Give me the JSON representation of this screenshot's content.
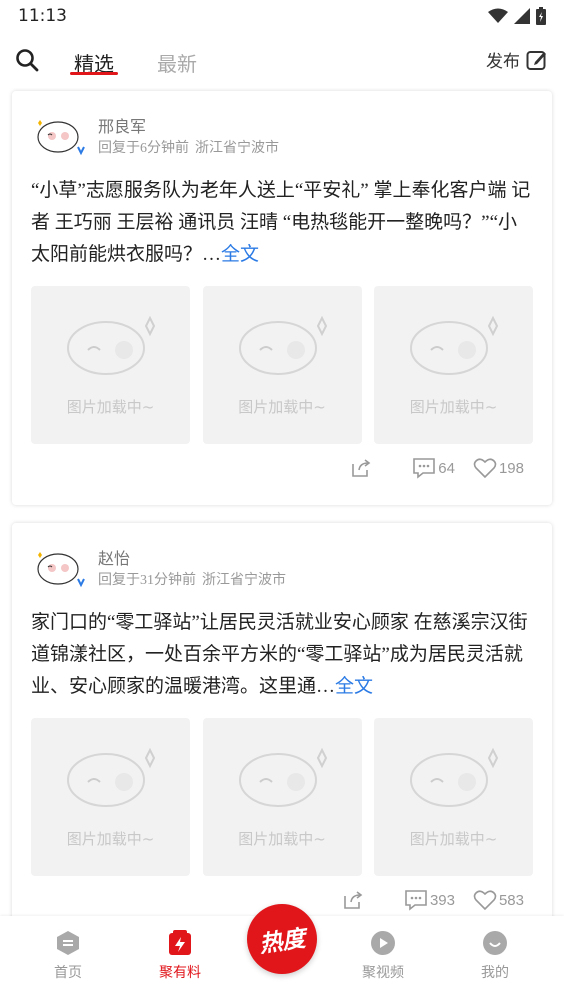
{
  "status_bar": {
    "time": "11:13"
  },
  "top_bar": {
    "tabs": [
      {
        "label": "精选"
      },
      {
        "label": "最新"
      }
    ],
    "publish_label": "发布"
  },
  "posts": [
    {
      "author": "邢良军",
      "reply_time": "回复于6分钟前",
      "location": "浙江省宁波市",
      "text": "“小草”志愿服务队为老年人送上“平安礼” 掌上奉化客户端 记者 王巧丽 王层裕 通讯员 汪晴 “电热毯能开一整晚吗？”“小太阳前能烘衣服吗？…",
      "full_link": "全文",
      "image_placeholder": "图片加载中~",
      "comments": "64",
      "likes": "198"
    },
    {
      "author": "赵怡",
      "reply_time": "回复于31分钟前",
      "location": "浙江省宁波市",
      "text": "家门口的“零工驿站”让居民灵活就业安心顾家 在慈溪宗汉街道锦漾社区，一处百余平方米的“零工驿站”成为居民灵活就业、安心顾家的温暖港湾。这里通…",
      "full_link": "全文",
      "image_placeholder": "图片加载中~",
      "comments": "393",
      "likes": "583"
    }
  ],
  "bottom_nav": {
    "items": [
      {
        "label": "首页",
        "icon": "home-icon"
      },
      {
        "label": "聚有料",
        "icon": "lightning-icon"
      },
      {
        "label": "聚视频",
        "icon": "play-icon"
      },
      {
        "label": "我的",
        "icon": "profile-icon"
      }
    ],
    "center_label": "热度"
  },
  "colors": {
    "accent": "#e0161b",
    "link": "#2c7be5"
  }
}
